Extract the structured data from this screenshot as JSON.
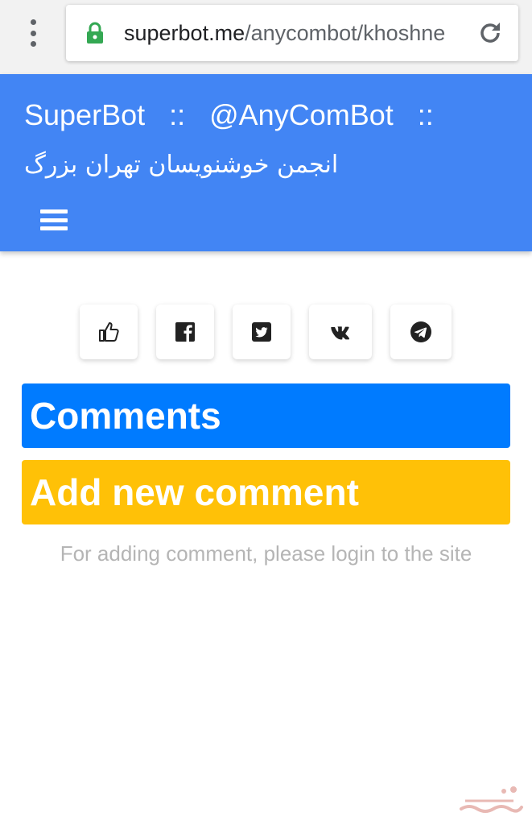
{
  "browser": {
    "url_host": "superbot.me",
    "url_path": "/anycombot/khoshne"
  },
  "header": {
    "site_name": "SuperBot",
    "separator": "::",
    "bot_name": "@AnyComBot",
    "trailing_separator": "::",
    "subtitle": "انجمن خوشنویسان تهران بزرگ"
  },
  "share": {
    "buttons": [
      "like-icon",
      "facebook-icon",
      "twitter-icon",
      "vk-icon",
      "telegram-icon"
    ]
  },
  "comments": {
    "title": "Comments",
    "add_title": "Add new comment",
    "login_note": "For adding comment, please login to the site"
  },
  "colors": {
    "header_bg": "#4285f4",
    "comments_bg": "#007bff",
    "add_bg": "#ffc107",
    "lock_green": "#34a853"
  }
}
